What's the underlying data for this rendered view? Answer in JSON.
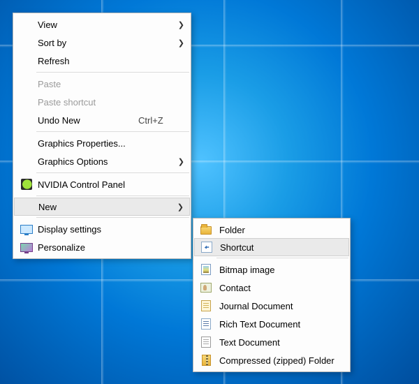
{
  "menu1": {
    "view": {
      "label": "View",
      "has_submenu": true
    },
    "sortby": {
      "label": "Sort by",
      "has_submenu": true
    },
    "refresh": {
      "label": "Refresh"
    },
    "paste": {
      "label": "Paste",
      "disabled": true
    },
    "paste_shortcut": {
      "label": "Paste shortcut",
      "disabled": true
    },
    "undo": {
      "label": "Undo New",
      "accel": "Ctrl+Z"
    },
    "gfx_props": {
      "label": "Graphics Properties..."
    },
    "gfx_opts": {
      "label": "Graphics Options",
      "has_submenu": true
    },
    "nvidia": {
      "label": "NVIDIA Control Panel"
    },
    "new": {
      "label": "New",
      "has_submenu": true,
      "highlighted": true
    },
    "display": {
      "label": "Display settings"
    },
    "personalize": {
      "label": "Personalize"
    }
  },
  "menu2": {
    "folder": {
      "label": "Folder"
    },
    "shortcut": {
      "label": "Shortcut",
      "highlighted": true
    },
    "bitmap": {
      "label": "Bitmap image"
    },
    "contact": {
      "label": "Contact"
    },
    "journal": {
      "label": "Journal Document"
    },
    "rtf": {
      "label": "Rich Text Document"
    },
    "txt": {
      "label": "Text Document"
    },
    "zip": {
      "label": "Compressed (zipped) Folder"
    }
  }
}
